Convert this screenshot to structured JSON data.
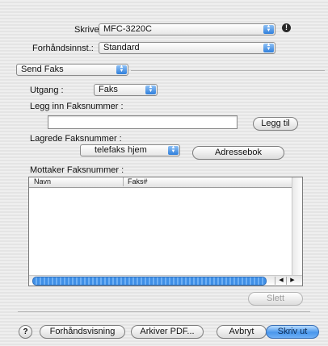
{
  "printer": {
    "label": "Skriver:",
    "value": "MFC-3220C"
  },
  "presets": {
    "label": "Forhåndsinnst.:",
    "value": "Standard"
  },
  "panel": {
    "value": "Send Faks"
  },
  "output": {
    "label": "Utgang :",
    "value": "Faks"
  },
  "fax_entry": {
    "label": "Legg inn Faksnummer :",
    "value": "",
    "add_button": "Legg til"
  },
  "stored": {
    "label": "Lagrede Faksnummer :",
    "value": "telefaks hjem",
    "addressbook_button": "Adressebok"
  },
  "recipients": {
    "label": "Mottaker Faksnummer :",
    "columns": [
      "Navn",
      "Faks#"
    ],
    "rows": [],
    "delete_button": "Slett"
  },
  "footer": {
    "help": "?",
    "preview_button": "Forhåndsvisning",
    "archive_button": "Arkiver PDF...",
    "cancel_button": "Avbryt",
    "print_button": "Skriv ut"
  },
  "colors": {
    "accent": "#3a8ee6",
    "default_button": "#4a97ec"
  }
}
